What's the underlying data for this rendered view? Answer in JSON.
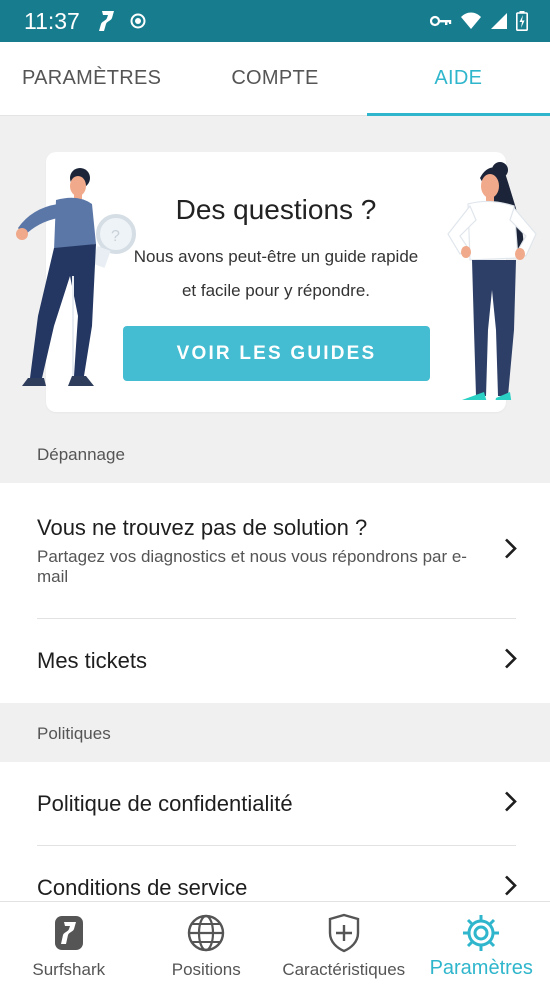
{
  "status_bar": {
    "time": "11:37",
    "icons": [
      "surfshark-logo-icon",
      "record-icon",
      "vpn-key-icon",
      "wifi-icon",
      "signal-icon",
      "battery-icon"
    ]
  },
  "tabs": [
    {
      "label": "PARAMÈTRES",
      "active": false
    },
    {
      "label": "COMPTE",
      "active": false
    },
    {
      "label": "AIDE",
      "active": true
    }
  ],
  "hero": {
    "title": "Des questions ?",
    "text": "Nous avons peut-être un guide rapide et facile pour y répondre.",
    "button_label": "VOIR LES GUIDES"
  },
  "sections": {
    "troubleshooting": {
      "label": "Dépannage",
      "items": [
        {
          "title": "Vous ne trouvez pas de solution ?",
          "subtitle": "Partagez vos diagnostics et nous vous répondrons par e-mail"
        },
        {
          "title": "Mes tickets"
        }
      ]
    },
    "policies": {
      "label": "Politiques",
      "items": [
        {
          "title": "Politique de confidentialité"
        },
        {
          "title": "Conditions de service"
        }
      ]
    }
  },
  "bottom_nav": [
    {
      "label": "Surfshark",
      "icon": "surfshark-logo-icon",
      "active": false
    },
    {
      "label": "Positions",
      "icon": "globe-icon",
      "active": false
    },
    {
      "label": "Caractéristiques",
      "icon": "shield-plus-icon",
      "active": false
    },
    {
      "label": "Paramètres",
      "icon": "gear-icon",
      "active": true
    }
  ],
  "colors": {
    "status_bar": "#177d8e",
    "accent": "#2fb6cc",
    "button": "#44bcd1",
    "background": "#f0f0f0"
  }
}
